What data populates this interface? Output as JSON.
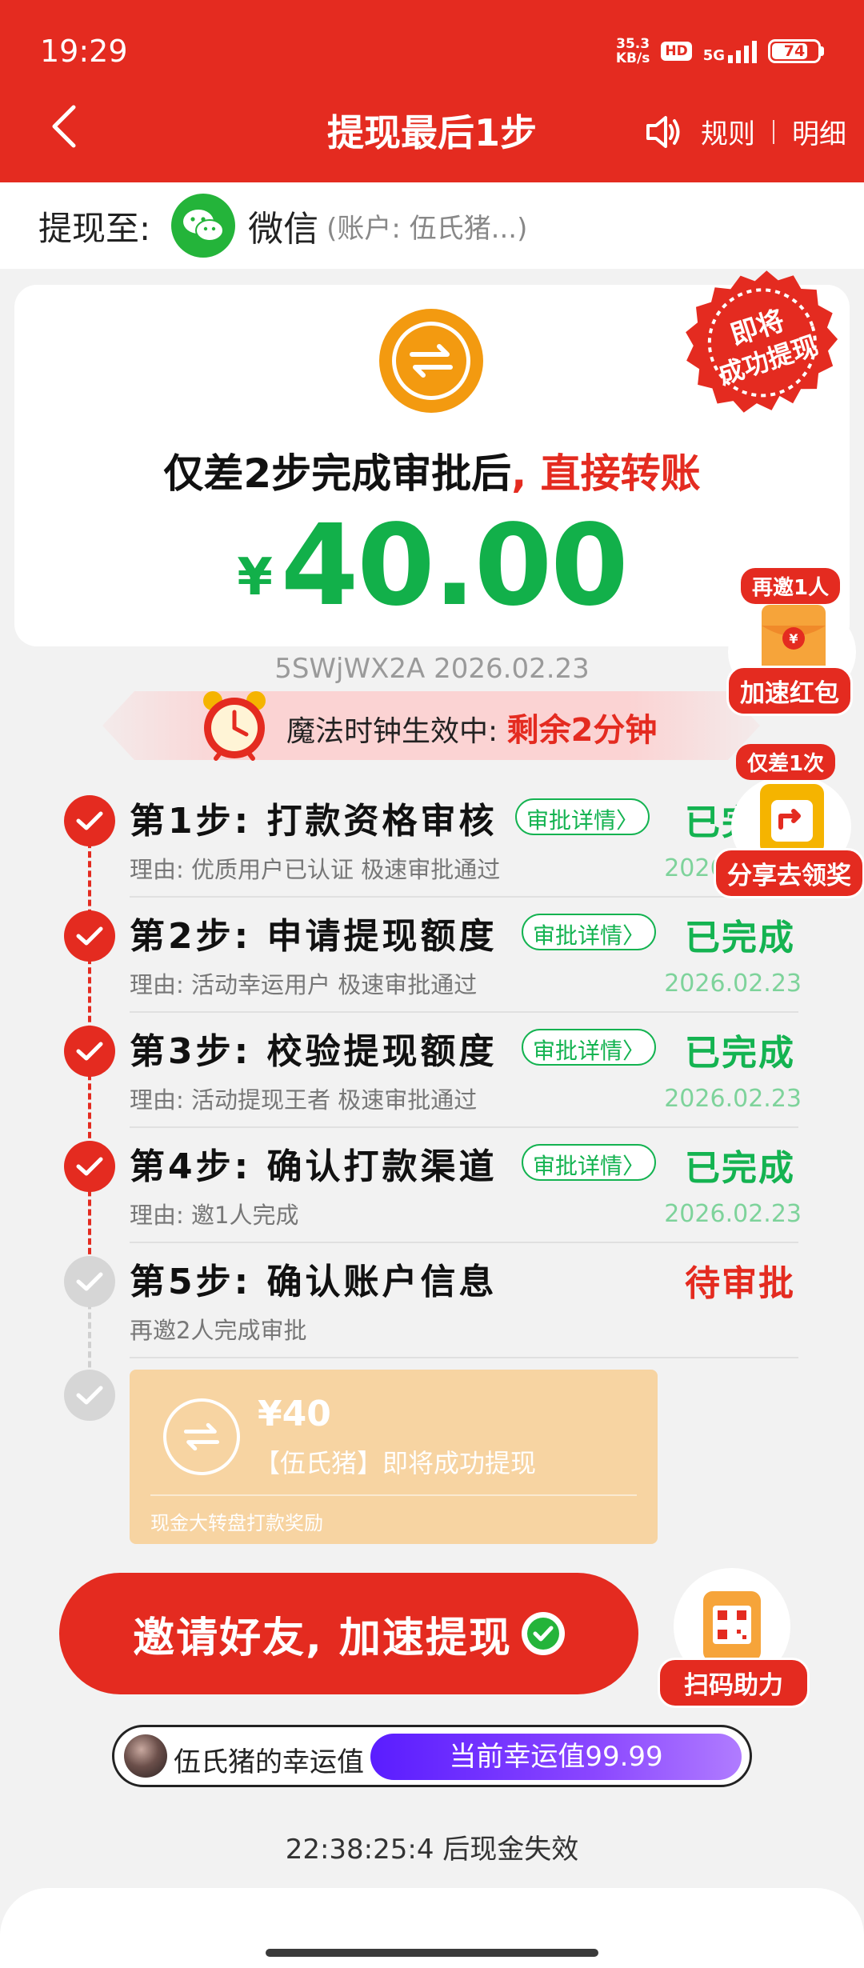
{
  "status_bar": {
    "time": "19:29",
    "net_speed_value": "35.3",
    "net_speed_unit": "KB/s",
    "hd": "HD",
    "network": "5G",
    "battery": "74"
  },
  "nav": {
    "title": "提现最后1步",
    "rules": "规则",
    "details": "明细"
  },
  "withdraw_to": {
    "label": "提现至:",
    "method": "微信",
    "account": "(账户: 伍氏猪...)"
  },
  "main_card": {
    "headline_prefix": "仅差2步完成审批后",
    "headline_suffix": ", 直接转账",
    "currency": "¥",
    "amount": "40.00",
    "seal_line1": "即将",
    "seal_line2": "成功提现"
  },
  "code_date": "5SWjWX2A 2026.02.23",
  "clock_banner": {
    "text": "魔法时钟生效中: ",
    "remaining": "剩余2分钟"
  },
  "steps": [
    {
      "title": "第1步: 打款资格审核",
      "badge": "审批详情〉",
      "status": "已完成",
      "reason": "理由: 优质用户已认证 极速审批通过",
      "date": "2026.02.23"
    },
    {
      "title": "第2步: 申请提现额度",
      "badge": "审批详情〉",
      "status": "已完成",
      "reason": "理由: 活动幸运用户 极速审批通过",
      "date": "2026.02.23"
    },
    {
      "title": "第3步: 校验提现额度",
      "badge": "审批详情〉",
      "status": "已完成",
      "reason": "理由: 活动提现王者 极速审批通过",
      "date": "2026.02.23"
    },
    {
      "title": "第4步: 确认打款渠道",
      "badge": "审批详情〉",
      "status": "已完成",
      "reason": "理由: 邀1人完成",
      "date": "2026.02.23"
    },
    {
      "title": "第5步: 确认账户信息",
      "status": "待审批",
      "reason": "再邀2人完成审批"
    }
  ],
  "final_card": {
    "amount": "¥40",
    "text": "【伍氏猪】即将成功提现",
    "note": "现金大转盘打款奖励"
  },
  "float_redpacket": {
    "tag": "再邀1人",
    "label": "加速红包"
  },
  "float_share": {
    "tag": "仅差1次",
    "label": "分享去领奖"
  },
  "invite_button": "邀请好友, 加速提现",
  "scan_help": "扫码助力",
  "luck": {
    "name": "伍氏猪的幸运值",
    "value": "当前幸运值99.99"
  },
  "expiry": "22:38:25:4 后现金失效",
  "colors": {
    "primary_red": "#e42b20",
    "success_green": "#12b04a",
    "orange": "#f39a10",
    "peach": "#f7d4a2",
    "purple": "#6a2cff"
  }
}
